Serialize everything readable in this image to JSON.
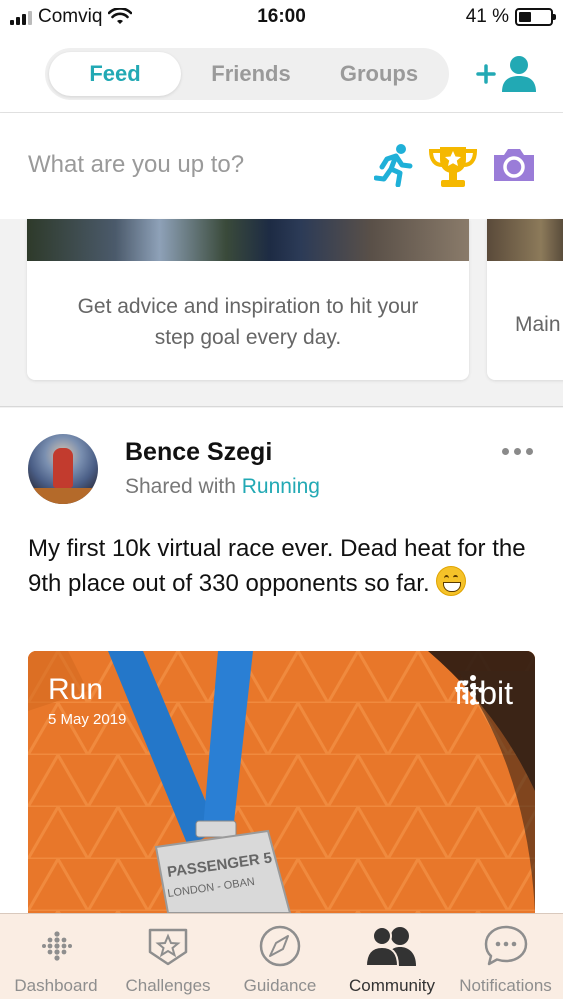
{
  "status_bar": {
    "carrier": "Comviq",
    "time": "16:00",
    "battery_text": "41 %",
    "battery_level": 0.41
  },
  "header": {
    "tabs": [
      {
        "label": "Feed",
        "active": true
      },
      {
        "label": "Friends",
        "active": false
      },
      {
        "label": "Groups",
        "active": false
      }
    ],
    "add_friend_icon": "add-friend-icon"
  },
  "composer": {
    "placeholder": "What are you up to?",
    "icons": [
      "runner-icon",
      "trophy-icon",
      "camera-icon"
    ]
  },
  "carousel": {
    "cards": [
      {
        "text": "Get advice and inspiration to hit your step goal every day."
      },
      {
        "text": "Main"
      }
    ]
  },
  "post": {
    "author": "Bence Szegi",
    "shared_prefix": "Shared with",
    "shared_group": "Running",
    "text": "My first 10k virtual race ever. Dead heat for the 9th place out of 330 opponents so far.",
    "emoji": "grinning-face-emoji",
    "photo": {
      "activity": "Run",
      "date": "5 May 2019",
      "brand": "fitbit"
    }
  },
  "tabbar": {
    "items": [
      {
        "label": "Dashboard",
        "icon": "dots-grid-icon",
        "active": false
      },
      {
        "label": "Challenges",
        "icon": "star-badge-icon",
        "active": false
      },
      {
        "label": "Guidance",
        "icon": "compass-icon",
        "active": false
      },
      {
        "label": "Community",
        "icon": "people-icon",
        "active": true
      },
      {
        "label": "Notifications",
        "icon": "chat-bubble-icon",
        "active": false
      }
    ]
  },
  "colors": {
    "accent": "#22a9b4",
    "runner": "#1fb0d8",
    "trophy": "#f5b800",
    "camera": "#9a7cd8"
  }
}
